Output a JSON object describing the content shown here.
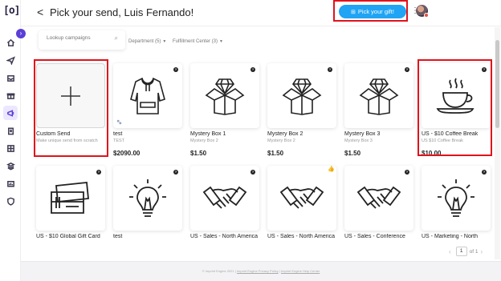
{
  "app": {
    "logo": "[o]"
  },
  "header": {
    "back_glyph": "<",
    "title": "Pick your send, Luis Fernando!",
    "gift_button": "Pick your gift!",
    "gift_icon": "gift-icon",
    "menu_glyph": "⋮"
  },
  "sidebar": {
    "collapse_glyph": "›",
    "items": [
      {
        "icon": "home-icon",
        "active": false
      },
      {
        "icon": "send-icon",
        "active": false
      },
      {
        "icon": "inbox-icon",
        "active": false
      },
      {
        "icon": "gift-box-icon",
        "active": false
      },
      {
        "icon": "campaign-icon",
        "active": true
      },
      {
        "icon": "clipboard-icon",
        "active": false
      },
      {
        "icon": "grid-icon",
        "active": false
      },
      {
        "icon": "stack-icon",
        "active": false
      },
      {
        "icon": "dashboard-icon",
        "active": false
      },
      {
        "icon": "shield-icon",
        "active": false
      }
    ]
  },
  "filters": {
    "search_placeholder": "Lookup campaigns",
    "department_label": "Department (5)",
    "fulfillment_label": "Fulfillment Center (3)"
  },
  "cards_row1": [
    {
      "title": "Custom Send",
      "subtitle": "Make unique send from scratch",
      "price": "",
      "icon": "plus-icon"
    },
    {
      "title": "test",
      "subtitle": "TEST",
      "price": "$2090.00",
      "icon": "hoodie-icon"
    },
    {
      "title": "Mystery Box 1",
      "subtitle": "Mystery Box 2",
      "price": "$1.50",
      "icon": "mystery-box-icon"
    },
    {
      "title": "Mystery Box 2",
      "subtitle": "Mystery Box 2",
      "price": "$1.50",
      "icon": "mystery-box-icon"
    },
    {
      "title": "Mystery Box 3",
      "subtitle": "Mystery Box 3",
      "price": "$1.50",
      "icon": "mystery-box-icon"
    },
    {
      "title": "US - $10 Coffee Break",
      "subtitle": "US $10 Coffee Break",
      "price": "$10.00",
      "icon": "coffee-cup-icon"
    }
  ],
  "cards_row2": [
    {
      "title": "US - $10 Global Gift Card",
      "icon": "gift-card-icon"
    },
    {
      "title": "test",
      "icon": "lightbulb-icon"
    },
    {
      "title": "US - Sales - North America",
      "icon": "handshake-icon"
    },
    {
      "title": "US - Sales - North America",
      "icon": "handshake-icon"
    },
    {
      "title": "US - Sales - Conference",
      "icon": "handshake-icon"
    },
    {
      "title": "US - Marketing - North",
      "icon": "lightbulb-icon"
    }
  ],
  "pagination": {
    "current": "1",
    "of_label": "of 1",
    "prev": "‹",
    "next": "›"
  },
  "footer": {
    "copyright": "© Imprint Engine 2021",
    "privacy": "Imprint Engine Privacy Policy",
    "help": "Imprint Engine Help Center",
    "separator": "|"
  },
  "colors": {
    "accent": "#5b3fd6",
    "gift_button": "#20a4f3",
    "highlight": "#e1121b"
  }
}
